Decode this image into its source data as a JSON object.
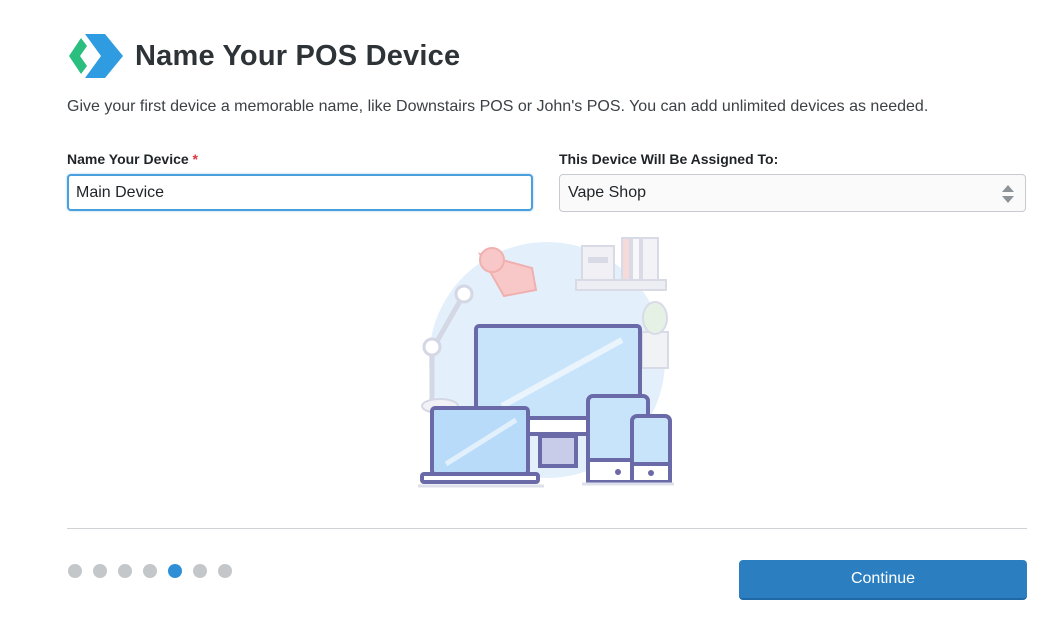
{
  "header": {
    "title": "Name Your POS Device",
    "logo_icon": "chevron-logo-icon",
    "logo_colors": {
      "green": "#2bbf7f",
      "blue": "#2f9be0"
    }
  },
  "description": "Give your first device a memorable name, like Downstairs POS or John's POS. You can add unlimited devices as needed.",
  "device_name": {
    "label": "Name Your Device",
    "required_marker": "*",
    "value": "Main Device"
  },
  "assignment": {
    "label": "This Device Will Be Assigned To:",
    "selected": "Vape Shop",
    "icon": "select-arrows-icon"
  },
  "illustration": {
    "icon": "devices-illustration"
  },
  "wizard": {
    "steps": 7,
    "current_step": 5,
    "active_color": "#2f8fd6"
  },
  "actions": {
    "continue_label": "Continue",
    "button_color": "#2b7fc1"
  }
}
